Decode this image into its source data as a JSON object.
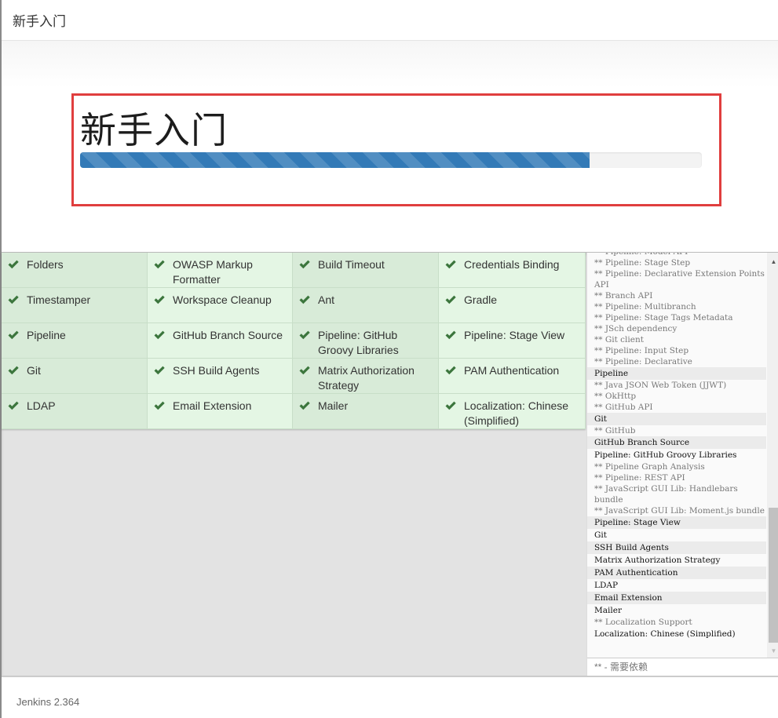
{
  "header": {
    "title": "新手入门"
  },
  "hero": {
    "title": "新手入门",
    "progress_percent": 82
  },
  "colors": {
    "accent": "#337ab7",
    "highlight_border": "#e03e3e",
    "check": "#3c763d",
    "cell_odd": "#d8ebd8",
    "cell_even": "#e4f6e4"
  },
  "plugins": [
    {
      "name": "Folders",
      "status": "installed"
    },
    {
      "name": "OWASP Markup Formatter",
      "status": "installed"
    },
    {
      "name": "Build Timeout",
      "status": "installed"
    },
    {
      "name": "Credentials Binding",
      "status": "installed"
    },
    {
      "name": "Timestamper",
      "status": "installed"
    },
    {
      "name": "Workspace Cleanup",
      "status": "installed"
    },
    {
      "name": "Ant",
      "status": "installed"
    },
    {
      "name": "Gradle",
      "status": "installed"
    },
    {
      "name": "Pipeline",
      "status": "installed"
    },
    {
      "name": "GitHub Branch Source",
      "status": "installed"
    },
    {
      "name": "Pipeline: GitHub Groovy Libraries",
      "status": "installed"
    },
    {
      "name": "Pipeline: Stage View",
      "status": "installed"
    },
    {
      "name": "Git",
      "status": "installed"
    },
    {
      "name": "SSH Build Agents",
      "status": "installed"
    },
    {
      "name": "Matrix Authorization Strategy",
      "status": "installed"
    },
    {
      "name": "PAM Authentication",
      "status": "installed"
    },
    {
      "name": "LDAP",
      "status": "installed"
    },
    {
      "name": "Email Extension",
      "status": "installed"
    },
    {
      "name": "Mailer",
      "status": "installed"
    },
    {
      "name": "Localization: Chinese (Simplified)",
      "status": "installed"
    }
  ],
  "install_log": [
    {
      "text": "** Pipeline: Model API",
      "type": "dep"
    },
    {
      "text": "** Pipeline: Stage Step",
      "type": "dep"
    },
    {
      "text": "** Pipeline: Declarative Extension Points API",
      "type": "dep"
    },
    {
      "text": "** Branch API",
      "type": "dep"
    },
    {
      "text": "** Pipeline: Multibranch",
      "type": "dep"
    },
    {
      "text": "** Pipeline: Stage Tags Metadata",
      "type": "dep"
    },
    {
      "text": "** JSch dependency",
      "type": "dep"
    },
    {
      "text": "** Git client",
      "type": "dep"
    },
    {
      "text": "** Pipeline: Input Step",
      "type": "dep"
    },
    {
      "text": "** Pipeline: Declarative",
      "type": "dep"
    },
    {
      "text": "Pipeline",
      "type": "main",
      "shade": true
    },
    {
      "text": "** Java JSON Web Token (JJWT)",
      "type": "dep"
    },
    {
      "text": "** OkHttp",
      "type": "dep"
    },
    {
      "text": "** GitHub API",
      "type": "dep"
    },
    {
      "text": "Git",
      "type": "main",
      "shade": true
    },
    {
      "text": "** GitHub",
      "type": "dep"
    },
    {
      "text": "GitHub Branch Source",
      "type": "main",
      "shade": true
    },
    {
      "text": "Pipeline: GitHub Groovy Libraries",
      "type": "main",
      "shade": false
    },
    {
      "text": "** Pipeline Graph Analysis",
      "type": "dep"
    },
    {
      "text": "** Pipeline: REST API",
      "type": "dep"
    },
    {
      "text": "** JavaScript GUI Lib: Handlebars bundle",
      "type": "dep"
    },
    {
      "text": "** JavaScript GUI Lib: Moment.js bundle",
      "type": "dep"
    },
    {
      "text": "Pipeline: Stage View",
      "type": "main",
      "shade": true
    },
    {
      "text": "Git",
      "type": "main",
      "shade": false
    },
    {
      "text": "SSH Build Agents",
      "type": "main",
      "shade": true
    },
    {
      "text": "Matrix Authorization Strategy",
      "type": "main",
      "shade": false
    },
    {
      "text": "PAM Authentication",
      "type": "main",
      "shade": true
    },
    {
      "text": "LDAP",
      "type": "main",
      "shade": false
    },
    {
      "text": "Email Extension",
      "type": "main",
      "shade": true
    },
    {
      "text": "Mailer",
      "type": "main",
      "shade": false
    },
    {
      "text": "** Localization Support",
      "type": "dep"
    },
    {
      "text": "Localization: Chinese (Simplified)",
      "type": "main",
      "shade": false
    }
  ],
  "log_footer": "** - 需要依赖",
  "footer": {
    "version": "Jenkins 2.364"
  },
  "icons": {
    "check": "check-icon",
    "scroll_up": "▲",
    "scroll_down": "▼"
  }
}
